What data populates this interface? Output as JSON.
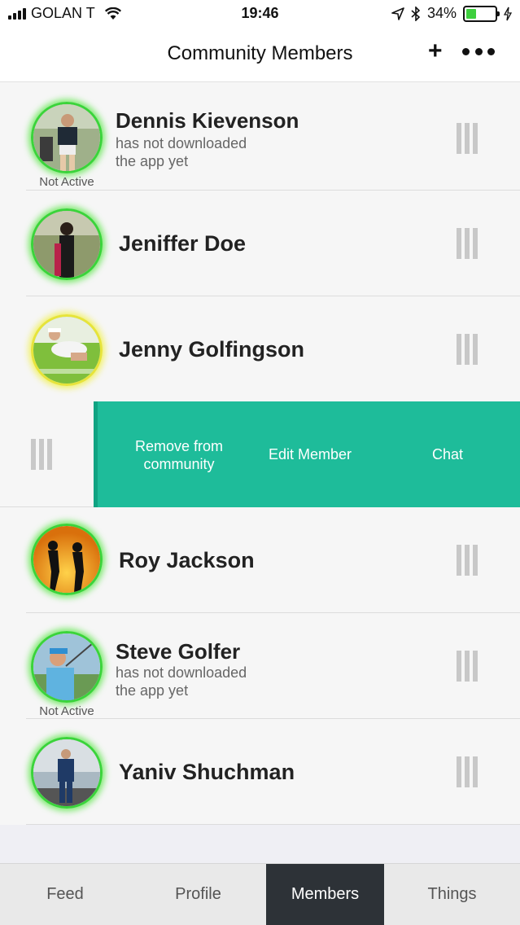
{
  "status_bar": {
    "carrier": "GOLAN T",
    "time": "19:46",
    "battery_percent": "34%",
    "battery_level": 0.34,
    "icons": [
      "signal-icon",
      "wifi-icon",
      "location-icon",
      "bluetooth-icon",
      "battery-icon",
      "charging-icon"
    ]
  },
  "nav": {
    "title": "Community Members",
    "add_label": "+",
    "more_icon": "more-dots-icon"
  },
  "members": [
    {
      "name": "Dennis Kievenson",
      "status_line1": "has not downloaded",
      "status_line2": "the app yet",
      "badge": "Not Active",
      "ring_color": "#3ad43a"
    },
    {
      "name": "Jeniffer Doe",
      "ring_color": "#3ad43a"
    },
    {
      "name": "Jenny Golfingson",
      "ring_color": "#e7e43a"
    },
    {
      "name": "Roy Jackson",
      "ring_color": "#3ad43a"
    },
    {
      "name": "Steve Golfer",
      "status_line1": "has not downloaded",
      "status_line2": "the app yet",
      "badge": "Not Active",
      "ring_color": "#3ad43a"
    },
    {
      "name": "Yaniv Shuchman",
      "ring_color": "#3ad43a"
    }
  ],
  "swipe_actions": {
    "remove_line1": "Remove from",
    "remove_line2": "community",
    "edit": "Edit Member",
    "chat": "Chat",
    "color": "#1ebc9a"
  },
  "tabs": [
    {
      "label": "Feed",
      "active": false
    },
    {
      "label": "Profile",
      "active": false
    },
    {
      "label": "Members",
      "active": true
    },
    {
      "label": "Things",
      "active": false
    }
  ]
}
